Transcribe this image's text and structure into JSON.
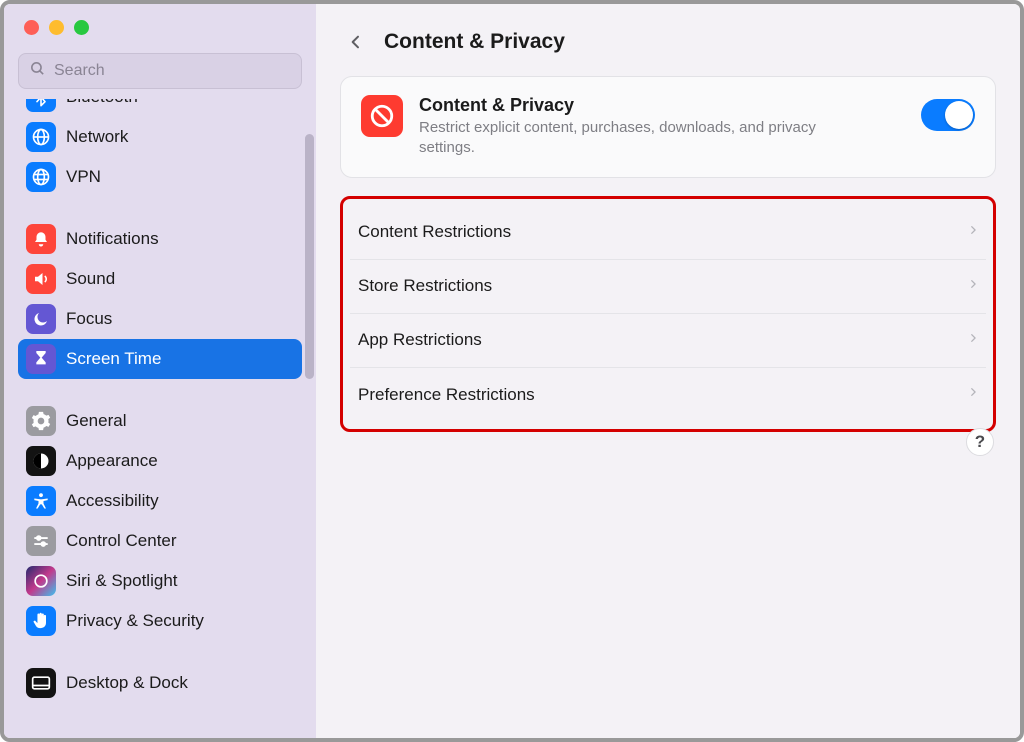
{
  "search": {
    "placeholder": "Search"
  },
  "sidebar": {
    "groups": [
      [
        {
          "id": "bluetooth",
          "label": "Bluetooth"
        },
        {
          "id": "network",
          "label": "Network"
        },
        {
          "id": "vpn",
          "label": "VPN"
        }
      ],
      [
        {
          "id": "notifications",
          "label": "Notifications"
        },
        {
          "id": "sound",
          "label": "Sound"
        },
        {
          "id": "focus",
          "label": "Focus"
        },
        {
          "id": "screentime",
          "label": "Screen Time",
          "selected": true
        }
      ],
      [
        {
          "id": "general",
          "label": "General"
        },
        {
          "id": "appearance",
          "label": "Appearance"
        },
        {
          "id": "accessibility",
          "label": "Accessibility"
        },
        {
          "id": "controlcenter",
          "label": "Control Center"
        },
        {
          "id": "siri",
          "label": "Siri & Spotlight"
        },
        {
          "id": "privacy",
          "label": "Privacy & Security"
        }
      ],
      [
        {
          "id": "desktop",
          "label": "Desktop & Dock"
        }
      ]
    ]
  },
  "header": {
    "title": "Content & Privacy"
  },
  "feature": {
    "title": "Content & Privacy",
    "description": "Restrict explicit content, purchases, downloads, and privacy settings.",
    "toggle_on": true
  },
  "restrictions": [
    {
      "label": "Content Restrictions"
    },
    {
      "label": "Store Restrictions"
    },
    {
      "label": "App Restrictions"
    },
    {
      "label": "Preference Restrictions"
    }
  ],
  "help": {
    "label": "?"
  }
}
